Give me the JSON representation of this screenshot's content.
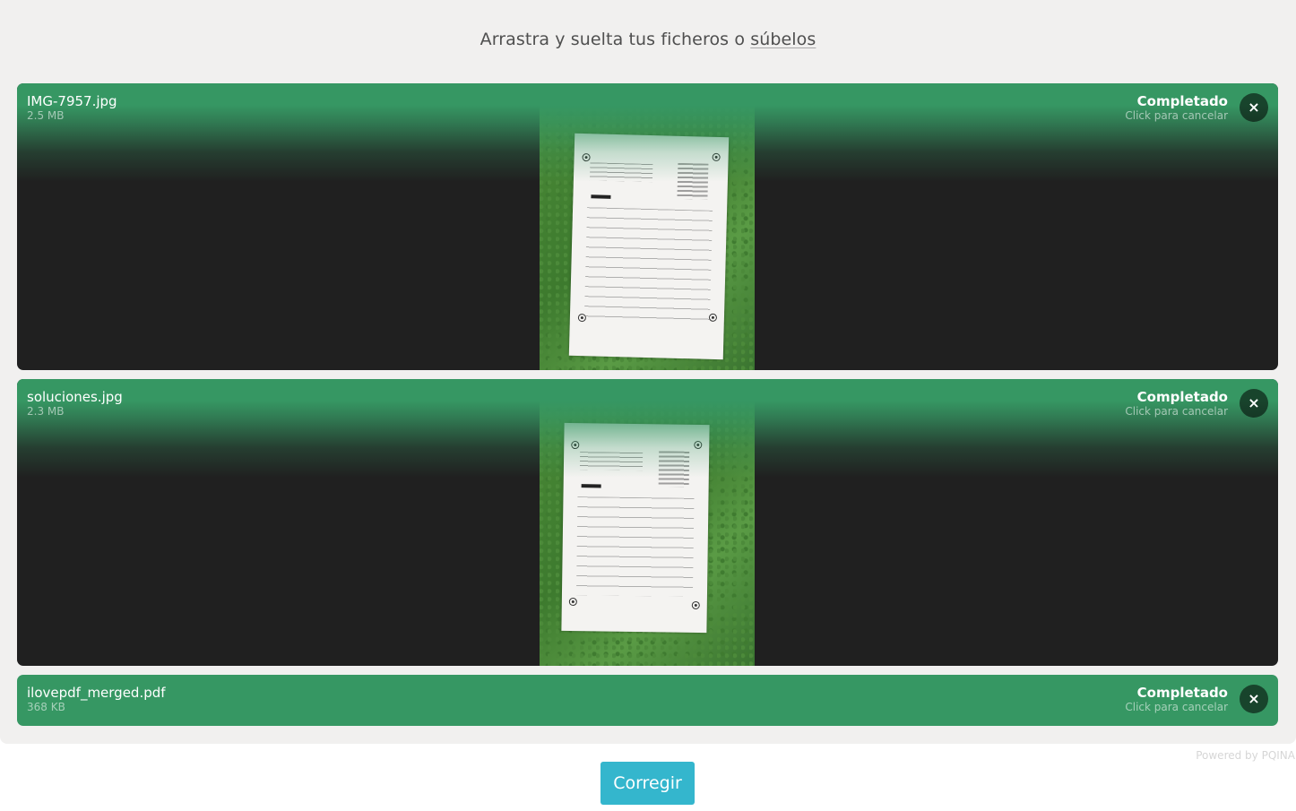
{
  "drop_area": {
    "label": "Arrastra y suelta tus ficheros o ",
    "browse_link": "súbelos"
  },
  "files": [
    {
      "name": "IMG-7957.jpg",
      "size": "2.5 MB",
      "status": "Completado",
      "status_hint": "Click para cancelar",
      "close_icon": "×"
    },
    {
      "name": "soluciones.jpg",
      "size": "2.3 MB",
      "status": "Completado",
      "status_hint": "Click para cancelar",
      "close_icon": "×"
    },
    {
      "name": "ilovepdf_merged.pdf",
      "size": "368 KB",
      "status": "Completado",
      "status_hint": "Click para cancelar",
      "close_icon": "×"
    }
  ],
  "credits": "Powered by PQINA",
  "submit_label": "Corregir",
  "colors": {
    "success": "#369763",
    "panel": "#f1f0ef",
    "button": "#34b6cd"
  }
}
